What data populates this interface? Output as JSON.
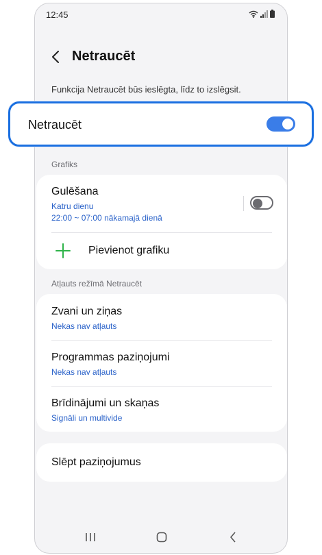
{
  "status": {
    "time": "12:45"
  },
  "header": {
    "title": "Netraucēt"
  },
  "description": "Funkcija Netraucēt būs ieslēgta, līdz to izslēgsit.",
  "main_toggle": {
    "label": "Netraucēt",
    "state": "on"
  },
  "schedule": {
    "section_label": "Grafiks",
    "item": {
      "title": "Gulēšana",
      "days": "Katru dienu",
      "time": "22:00 ~ 07:00 nākamajā dienā",
      "state": "off"
    },
    "add_label": "Pievienot grafiku"
  },
  "allowed": {
    "section_label": "Atļauts režīmā Netraucēt",
    "items": [
      {
        "title": "Zvani un ziņas",
        "sub": "Nekas nav atļauts"
      },
      {
        "title": "Programmas paziņojumi",
        "sub": "Nekas nav atļauts"
      },
      {
        "title": "Brīdinājumi un skaņas",
        "sub": "Signāli un multivide"
      }
    ]
  },
  "hide": {
    "title": "Slēpt paziņojumus"
  },
  "colors": {
    "accent": "#3a7de8",
    "highlight_border": "#1a6fe0",
    "link": "#2a62c9",
    "add_icon": "#2fb34a"
  },
  "icons": [
    "wifi-icon",
    "signal-icon",
    "battery-icon",
    "back-chevron-icon",
    "plus-icon",
    "recents-icon",
    "home-icon",
    "back-icon"
  ]
}
